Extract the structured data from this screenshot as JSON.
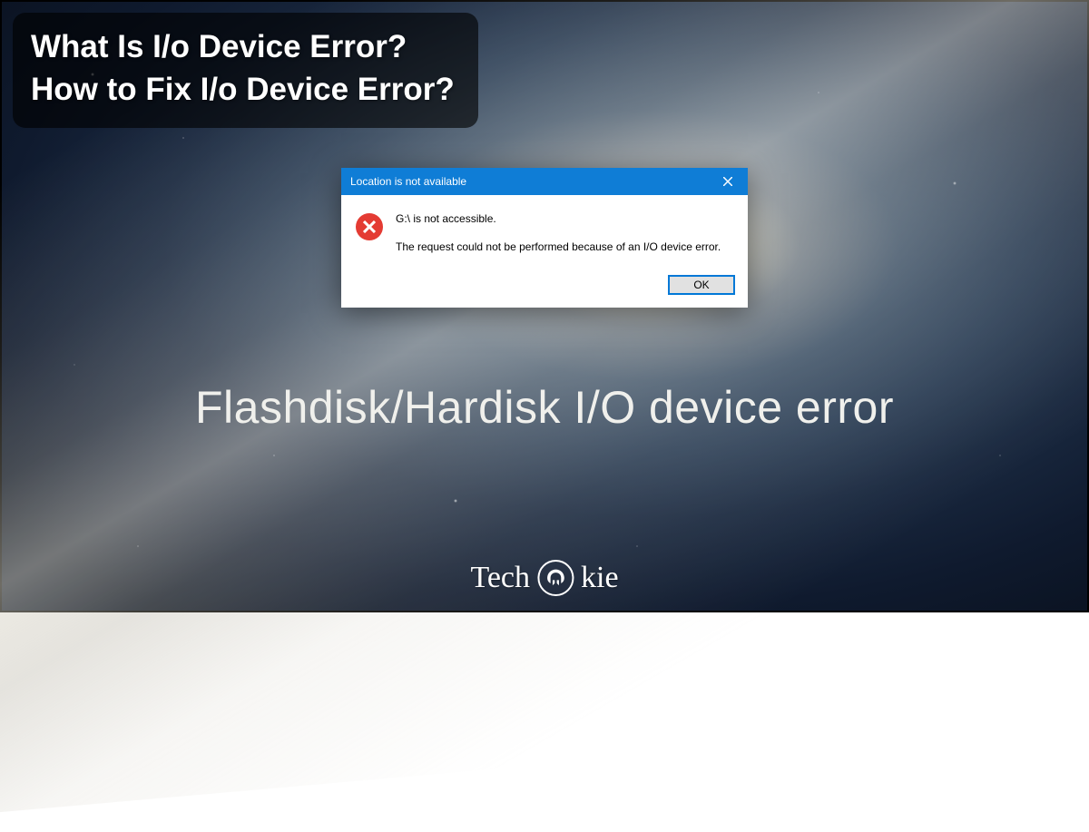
{
  "title_overlay": {
    "line1": "What Is I/o Device Error?",
    "line2": "How to Fix I/o Device Error?"
  },
  "dialog": {
    "title": "Location is not available",
    "message_line1": "G:\\ is not accessible.",
    "message_line2": "The request could not be performed because of an I/O device error.",
    "ok_label": "OK"
  },
  "main_caption": "Flashdisk/Hardisk I/O device error",
  "brand": {
    "prefix": "Tech",
    "suffix": "kie"
  }
}
